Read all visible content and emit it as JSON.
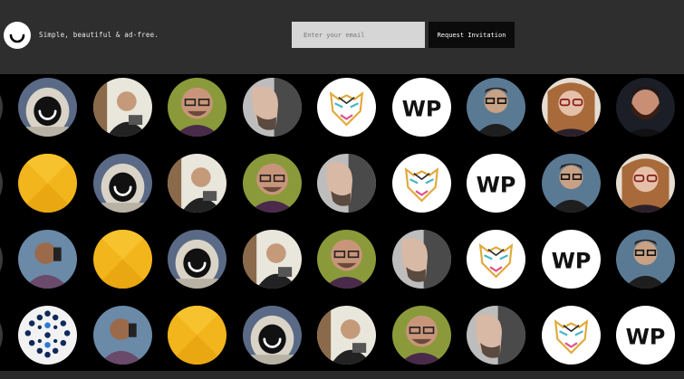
{
  "header": {
    "tagline": "Simple, beautiful & ad-free.",
    "email_placeholder": "Enter your email",
    "request_button_label": "Request Invitation"
  },
  "avatars": {
    "rows": [
      [
        "astronaut",
        "desk-man",
        "glasses-man",
        "profile-man",
        "tiger",
        "wp-logo",
        "glasses-man-blue",
        "glasses-woman",
        "bearded-man"
      ],
      [
        "yellow-disc",
        "astronaut",
        "desk-man",
        "glasses-man",
        "profile-man",
        "tiger",
        "wp-logo",
        "glasses-man-blue",
        "glasses-woman"
      ],
      [
        "phone-man",
        "yellow-disc",
        "astronaut",
        "desk-man",
        "glasses-man",
        "profile-man",
        "tiger",
        "wp-logo",
        "glasses-man-blue"
      ],
      [
        "dot-pattern",
        "phone-man",
        "yellow-disc",
        "astronaut",
        "desk-man",
        "glasses-man",
        "profile-man",
        "tiger",
        "wp-logo"
      ]
    ]
  },
  "colors": {
    "header_bg": "#2e2e2e",
    "page_bg": "#000000",
    "input_bg": "#d6d6d6",
    "button_bg": "#0b0b0b",
    "yellow": "#f2b51b"
  }
}
